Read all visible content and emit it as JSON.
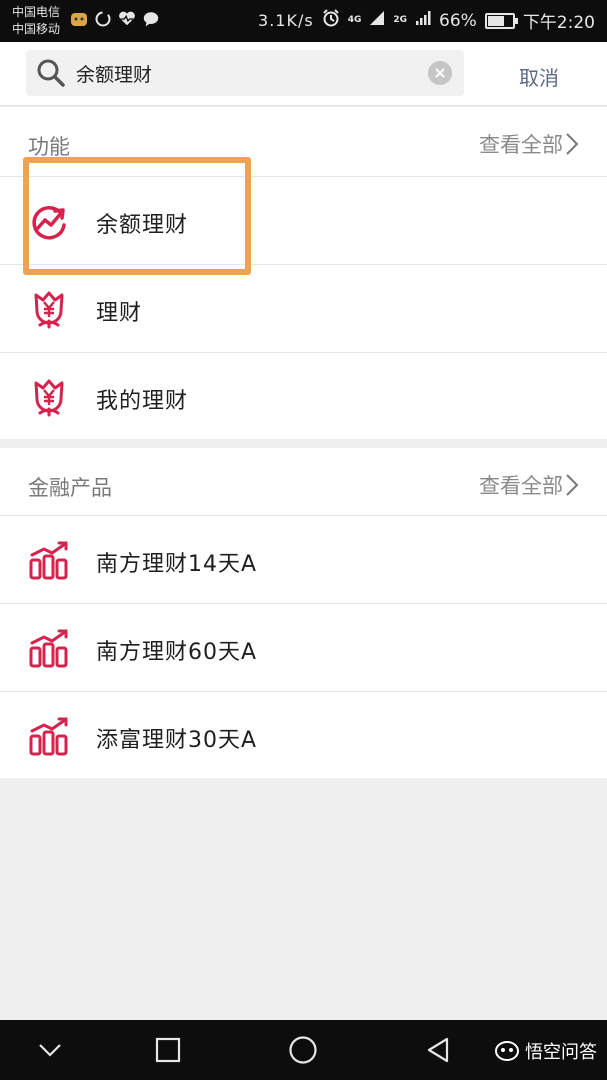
{
  "status_bar": {
    "carrier_1": "中国电信",
    "carrier_2": "中国移动",
    "speed": "3.1K/s",
    "net_4g": "4G",
    "net_2g": "2G",
    "battery": "66%",
    "battery_level": 0.66,
    "time": "下午2:20"
  },
  "search": {
    "value": "余额理财",
    "cancel_label": "取消"
  },
  "functions": {
    "title": "功能",
    "view_all": "查看全部",
    "items": [
      {
        "label": "余额理财",
        "icon": "balance-growth-icon"
      },
      {
        "label": "理财",
        "icon": "money-flower-icon"
      },
      {
        "label": "我的理财",
        "icon": "money-flower-icon"
      }
    ]
  },
  "products": {
    "title": "金融产品",
    "view_all": "查看全部",
    "items": [
      {
        "label": "南方理财14天A",
        "icon": "bar-chart-icon"
      },
      {
        "label": "南方理财60天A",
        "icon": "bar-chart-icon"
      },
      {
        "label": "添富理财30天A",
        "icon": "bar-chart-icon"
      }
    ]
  },
  "watermark": {
    "text": "悟空问答"
  },
  "colors": {
    "accent": "#d6224c",
    "highlight": "#f0a154",
    "link": "#5b6a86"
  }
}
